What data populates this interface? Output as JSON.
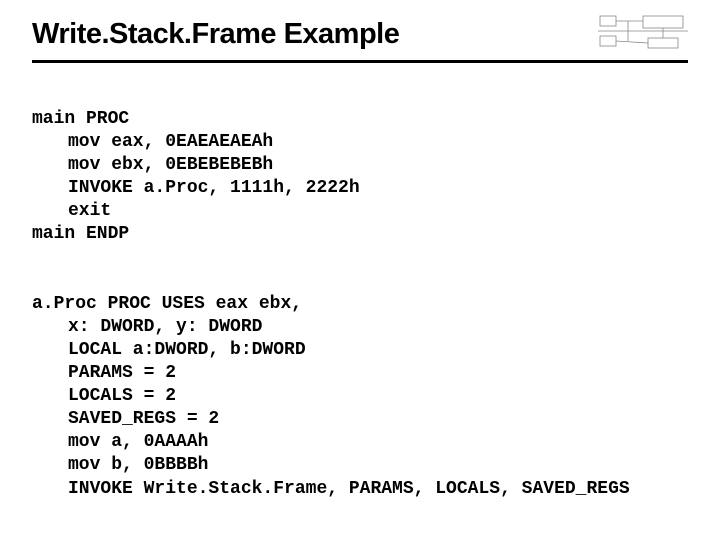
{
  "title": "Write.Stack.Frame Example",
  "main_proc": {
    "open": "main PROC",
    "l1": "mov eax, 0EAEAEAEAh",
    "l2": "mov ebx, 0EBEBEBEBh",
    "l3": "INVOKE a.Proc, 1111h, 2222h",
    "l4": "exit",
    "close": "main ENDP"
  },
  "a_proc": {
    "open": "a.Proc PROC USES eax ebx,",
    "l1": "x: DWORD, y: DWORD",
    "l2": "LOCAL a:DWORD, b:DWORD",
    "l3": "PARAMS = 2",
    "l4": "LOCALS = 2",
    "l5": "SAVED_REGS = 2",
    "l6": "mov a, 0AAAAh",
    "l7": "mov b, 0BBBBh",
    "l8": "INVOKE Write.Stack.Frame, PARAMS, LOCALS, SAVED_REGS"
  }
}
